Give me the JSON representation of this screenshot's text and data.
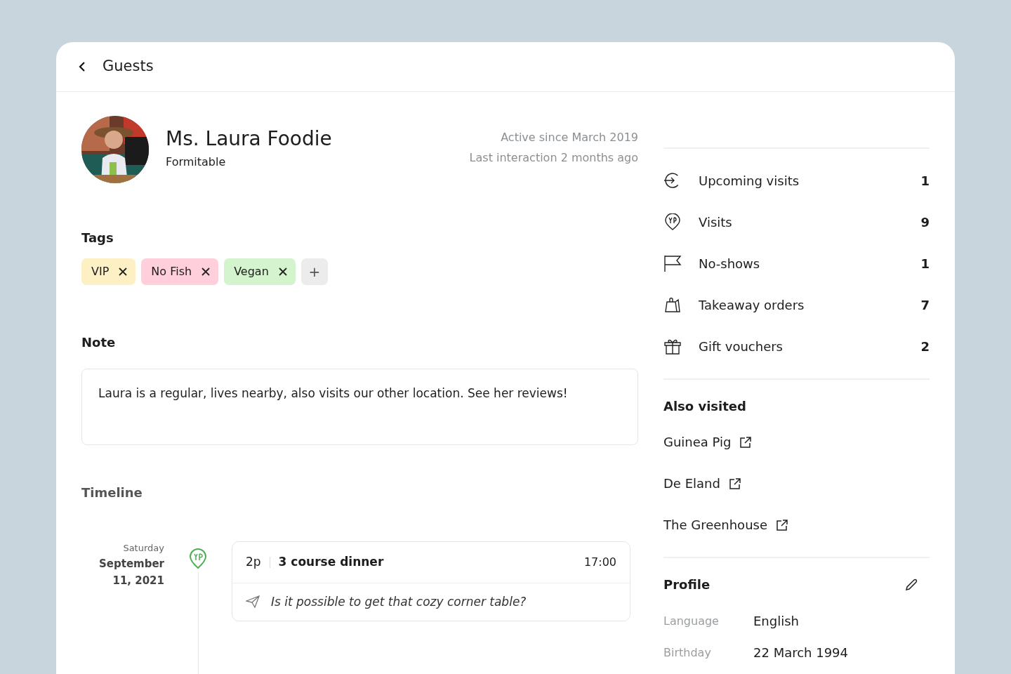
{
  "header": {
    "title": "Guests"
  },
  "guest": {
    "name": "Ms. Laura Foodie",
    "source": "Formitable",
    "active_since": "Active since March 2019",
    "last_interaction": "Last interaction 2 months ago"
  },
  "tags": {
    "title": "Tags",
    "items": [
      {
        "label": "VIP",
        "color": "#fdf0c4"
      },
      {
        "label": "No Fish",
        "color": "#ffcfdc"
      },
      {
        "label": "Vegan",
        "color": "#d3f4cd"
      }
    ],
    "add": "+"
  },
  "note": {
    "title": "Note",
    "text": "Laura is a regular, lives nearby, also visits our other location. See her reviews!"
  },
  "timeline": {
    "title": "Timeline",
    "entries": [
      {
        "weekday": "Saturday",
        "date_line_1": "September",
        "date_line_2": "11, 2021",
        "party": "2p",
        "title": "3 course dinner",
        "time": "17:00",
        "message": "Is it possible to get that cozy corner table?"
      }
    ]
  },
  "stats": [
    {
      "kind": "upcoming",
      "label": "Upcoming visits",
      "count": "1"
    },
    {
      "kind": "visits",
      "label": "Visits",
      "count": "9"
    },
    {
      "kind": "noshows",
      "label": "No-shows",
      "count": "1"
    },
    {
      "kind": "takeaway",
      "label": "Takeaway orders",
      "count": "7"
    },
    {
      "kind": "gift",
      "label": "Gift vouchers",
      "count": "2"
    }
  ],
  "also_visited": {
    "title": "Also visited",
    "items": [
      "Guinea Pig",
      "De Eland",
      "The Greenhouse"
    ]
  },
  "profile": {
    "title": "Profile",
    "fields": [
      {
        "label": "Language",
        "value": "English"
      },
      {
        "label": "Birthday",
        "value": "22 March 1994"
      }
    ]
  }
}
